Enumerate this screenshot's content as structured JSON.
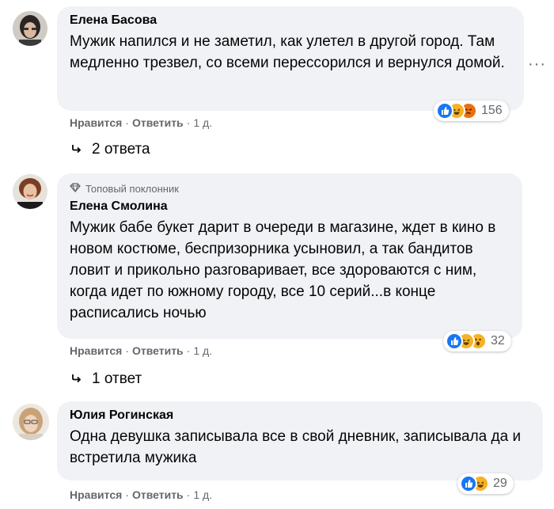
{
  "comments": [
    {
      "author": "Елена Басова",
      "badge": "",
      "text": "Мужик напился и не заметил, как улетел в другой город. Там медленно трезвел, со всеми перессорился и вернулся домой.",
      "like": "Нравится",
      "reply": "Ответить",
      "time": "1 д.",
      "reactions_count": "156",
      "replies": "2 ответа"
    },
    {
      "author": "Елена Смолина",
      "badge": "Топовый поклонник",
      "text": "Мужик бабе букет дарит в очереди в магазине, ждет в кино в новом костюме, беспризорника усыновил, а так бандитов ловит и прикольно разговаривает, все здороваются с ним, когда идет по южному городу, все 10 серий...в конце расписались ночью",
      "like": "Нравится",
      "reply": "Ответить",
      "time": "1 д.",
      "reactions_count": "32",
      "replies": "1 ответ"
    },
    {
      "author": "Юлия Рогинская",
      "badge": "",
      "text": "Одна девушка записывала все в свой дневник, записывала да и встретила мужика",
      "like": "Нравится",
      "reply": "Ответить",
      "time": "1 д.",
      "reactions_count": "29",
      "replies": ""
    }
  ],
  "icons": {
    "more": "more-horizontal-icon",
    "reply_arrow": "reply-arrow-icon",
    "badge": "diamond-icon"
  },
  "colors": {
    "bubble": "#f0f2f5",
    "secondary_text": "#65676b",
    "like_blue": "#1877f2"
  }
}
